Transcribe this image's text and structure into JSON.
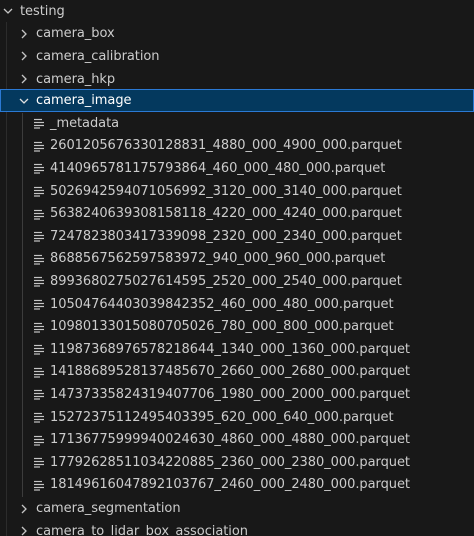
{
  "explorer": {
    "root": {
      "label": "testing",
      "expanded": true
    },
    "folders_before": [
      {
        "label": "camera_box",
        "expanded": false
      },
      {
        "label": "camera_calibration",
        "expanded": false
      },
      {
        "label": "camera_hkp",
        "expanded": false
      }
    ],
    "selected_folder": {
      "label": "camera_image",
      "expanded": true
    },
    "files": [
      "_metadata",
      "2601205676330128831_4880_000_4900_000.parquet",
      "4140965781175793864_460_000_480_000.parquet",
      "5026942594071056992_3120_000_3140_000.parquet",
      "5638240639308158118_4220_000_4240_000.parquet",
      "7247823803417339098_2320_000_2340_000.parquet",
      "8688567562597583972_940_000_960_000.parquet",
      "8993680275027614595_2520_000_2540_000.parquet",
      "10504764403039842352_460_000_480_000.parquet",
      "10980133015080705026_780_000_800_000.parquet",
      "11987368976578218644_1340_000_1360_000.parquet",
      "14188689528137485670_2660_000_2680_000.parquet",
      "14737335824319407706_1980_000_2000_000.parquet",
      "15272375112495403395_620_000_640_000.parquet",
      "17136775999940024630_4860_000_4880_000.parquet",
      "17792628511034220885_2360_000_2380_000.parquet",
      "18149616047892103767_2460_000_2480_000.parquet"
    ],
    "folders_after": [
      {
        "label": "camera_segmentation",
        "expanded": false
      },
      {
        "label": "camera_to_lidar_box_association",
        "expanded": false
      }
    ]
  },
  "icons": {
    "chevron_collapsed": "chevron-right-icon",
    "chevron_expanded": "chevron-down-icon",
    "file": "file-lines-icon"
  },
  "colors": {
    "background": "#181818",
    "text": "#cccccc",
    "selection_background": "#04395e",
    "selection_border": "#2b79d4"
  }
}
